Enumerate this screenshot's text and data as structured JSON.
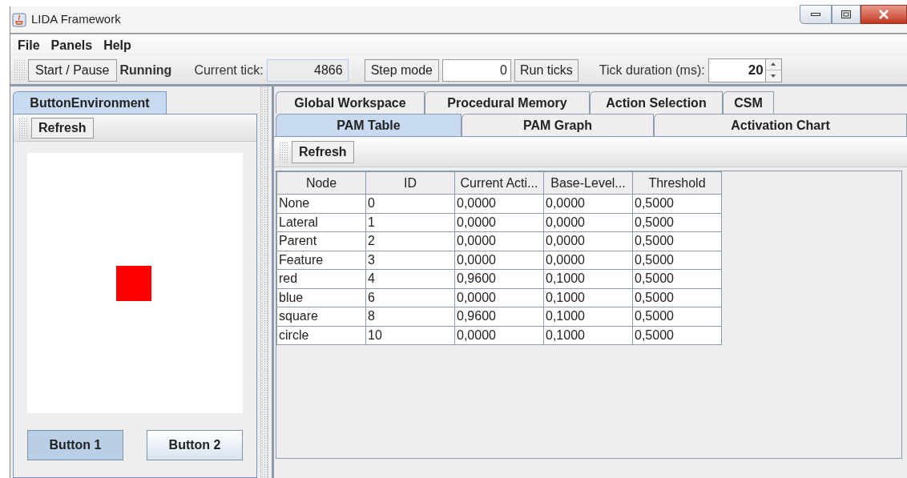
{
  "window": {
    "title": "LIDA Framework"
  },
  "menu": [
    "File",
    "Panels",
    "Help"
  ],
  "toolbar": {
    "start_pause": "Start / Pause",
    "status": "Running",
    "tick_label": "Current tick:",
    "tick_value": "4866",
    "step_mode": "Step mode",
    "step_value": "0",
    "run_ticks": "Run ticks",
    "duration_label": "Tick duration (ms):",
    "duration_value": "20"
  },
  "left_panel": {
    "tabs": [
      {
        "label": "ButtonEnvironment",
        "selected": true
      }
    ],
    "refresh": "Refresh",
    "buttons": [
      {
        "label": "Button 1",
        "selected": true
      },
      {
        "label": "Button 2",
        "selected": false
      }
    ]
  },
  "right_panel": {
    "tabs_row1": [
      {
        "label": "Global Workspace",
        "selected": false
      },
      {
        "label": "Procedural Memory",
        "selected": false
      },
      {
        "label": "Action Selection",
        "selected": false
      },
      {
        "label": "CSM",
        "selected": false
      }
    ],
    "tabs_row2": [
      {
        "label": "PAM Table",
        "selected": true
      },
      {
        "label": "PAM Graph",
        "selected": false
      },
      {
        "label": "Activation Chart",
        "selected": false
      }
    ],
    "refresh": "Refresh",
    "table": {
      "columns": [
        "Node",
        "ID",
        "Current Acti...",
        "Base-Level...",
        "Threshold"
      ],
      "rows": [
        [
          "None",
          "0",
          "0,0000",
          "0,0000",
          "0,5000"
        ],
        [
          "Lateral",
          "1",
          "0,0000",
          "0,0000",
          "0,5000"
        ],
        [
          "Parent",
          "2",
          "0,0000",
          "0,0000",
          "0,5000"
        ],
        [
          "Feature",
          "3",
          "0,0000",
          "0,0000",
          "0,5000"
        ],
        [
          "red",
          "4",
          "0,9600",
          "0,1000",
          "0,5000"
        ],
        [
          "blue",
          "6",
          "0,0000",
          "0,1000",
          "0,5000"
        ],
        [
          "square",
          "8",
          "0,9600",
          "0,1000",
          "0,5000"
        ],
        [
          "circle",
          "10",
          "0,0000",
          "0,1000",
          "0,5000"
        ]
      ]
    }
  }
}
